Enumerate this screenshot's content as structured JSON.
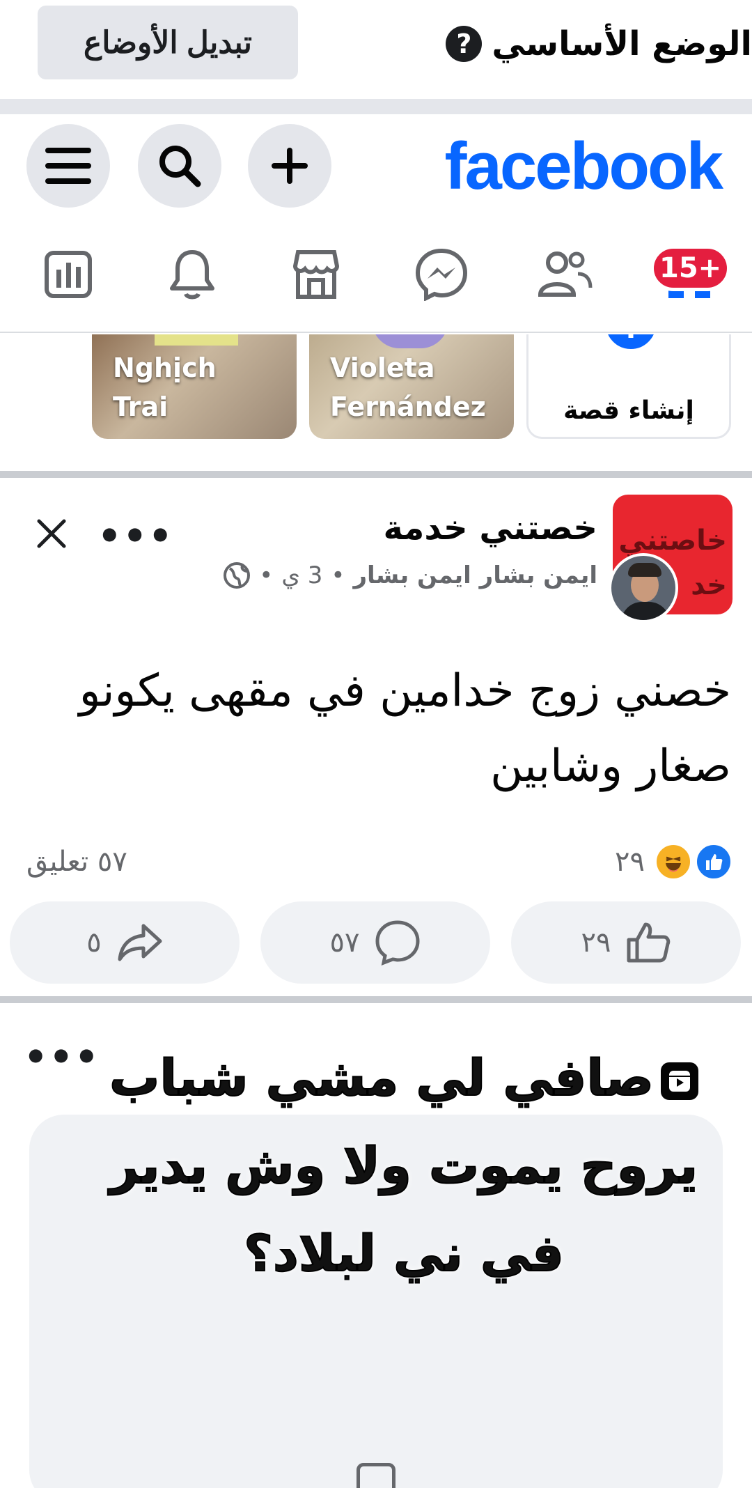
{
  "mode_bar": {
    "switch_label": "تبديل الأوضاع",
    "mode_label": "الوضع الأساسي",
    "help_icon": "question-circle-icon"
  },
  "header": {
    "logo": "facebook",
    "buttons": [
      "menu-icon",
      "search-icon",
      "plus-icon"
    ],
    "brand_color": "#0866ff"
  },
  "nav": {
    "home_badge": "15+",
    "items": [
      "home-icon",
      "friends-icon",
      "messenger-icon",
      "marketplace-icon",
      "bell-icon",
      "dashboard-icon"
    ]
  },
  "stories": {
    "create_label": "إنشاء قصة",
    "items": [
      {
        "name_line1": "Violeta",
        "name_line2": "Fernández"
      },
      {
        "name_line1": "Nghịch",
        "name_line2": "Trai"
      }
    ]
  },
  "post": {
    "page_name": "خصتني خدمة",
    "avatar_text_line1": "خاصتني",
    "avatar_text_line2": "خد",
    "author": "ايمن بشار ايمن بشار",
    "time": "3 ي",
    "dot": "•",
    "text": "خصني زوج خدامين في مقهى يكونو صغار وشابين",
    "reactions_count": "٢٩",
    "comments_summary": "٥٧ تعليق",
    "actions": {
      "like_count": "٢٩",
      "comment_count": "٥٧",
      "share_count": "٥"
    },
    "colors": {
      "like": "#1877f2",
      "haha": "#f7b125"
    }
  },
  "post2": {
    "reel_text": "صافي لي مشي شباب يروح يموت ولا وش يدير في ني لبلاد؟"
  }
}
